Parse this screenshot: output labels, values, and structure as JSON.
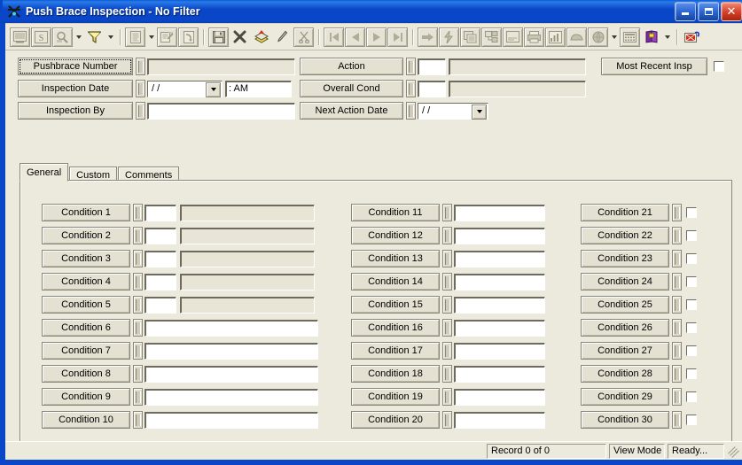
{
  "window": {
    "title": "Push Brace Inspection - No Filter",
    "app_icon": "push-brace-icon",
    "minimize_label": "Minimize",
    "maximize_label": "Maximize",
    "close_label": "Close"
  },
  "toolbar": {
    "groups": [
      {
        "buttons": [
          {
            "name": "design-view-icon",
            "label": "Design View",
            "dropdown": false,
            "enabled": false
          },
          {
            "name": "sort-records-icon",
            "label": "Sort Records",
            "dropdown": false,
            "enabled": false
          },
          {
            "name": "find-icon",
            "label": "Find",
            "dropdown": true,
            "enabled": false
          },
          {
            "name": "filter-funnel-icon",
            "label": "Filter",
            "dropdown": true,
            "enabled": true
          },
          {
            "name": "report-icon",
            "label": "Report",
            "dropdown": true,
            "enabled": false
          },
          {
            "name": "properties-icon",
            "label": "Properties",
            "dropdown": false,
            "enabled": false
          },
          {
            "name": "export-icon",
            "label": "Export",
            "dropdown": false,
            "enabled": false
          }
        ]
      },
      {
        "buttons": [
          {
            "name": "save-icon",
            "label": "Save",
            "dropdown": false,
            "enabled": false
          },
          {
            "name": "delete-icon",
            "label": "Delete",
            "dropdown": false,
            "enabled": true
          },
          {
            "name": "new-record-icon",
            "label": "New Record",
            "dropdown": false,
            "enabled": true
          },
          {
            "name": "edit-pencil-icon",
            "label": "Edit",
            "dropdown": false,
            "enabled": true
          },
          {
            "name": "cut-scissors-icon",
            "label": "Cut",
            "dropdown": false,
            "enabled": false
          }
        ]
      },
      {
        "buttons": [
          {
            "name": "first-record-icon",
            "label": "First Record",
            "dropdown": false,
            "enabled": false
          },
          {
            "name": "previous-record-icon",
            "label": "Previous Record",
            "dropdown": false,
            "enabled": false
          },
          {
            "name": "next-record-icon",
            "label": "Next Record",
            "dropdown": false,
            "enabled": false
          },
          {
            "name": "last-record-icon",
            "label": "Last Record",
            "dropdown": false,
            "enabled": false
          }
        ]
      },
      {
        "buttons": [
          {
            "name": "goto-icon",
            "label": "Go To",
            "dropdown": false,
            "enabled": false
          },
          {
            "name": "lightning-icon",
            "label": "Run",
            "dropdown": false,
            "enabled": false
          },
          {
            "name": "photos-icon",
            "label": "Photos",
            "dropdown": false,
            "enabled": false
          },
          {
            "name": "documents-icon",
            "label": "Documents",
            "dropdown": false,
            "enabled": false
          },
          {
            "name": "notes-icon",
            "label": "Notes",
            "dropdown": false,
            "enabled": false
          },
          {
            "name": "print-icon",
            "label": "Print",
            "dropdown": false,
            "enabled": false
          },
          {
            "name": "chart-icon",
            "label": "Chart",
            "dropdown": false,
            "enabled": false
          },
          {
            "name": "map-icon",
            "label": "Map",
            "dropdown": false,
            "enabled": false
          },
          {
            "name": "globe-icon",
            "label": "GIS",
            "dropdown": true,
            "enabled": false
          },
          {
            "name": "calculator-icon",
            "label": "Calculator",
            "dropdown": false,
            "enabled": false
          },
          {
            "name": "help-book-icon",
            "label": "Help",
            "dropdown": true,
            "enabled": true
          }
        ]
      },
      {
        "buttons": [
          {
            "name": "exit-icon",
            "label": "Exit",
            "dropdown": false,
            "enabled": true
          }
        ]
      }
    ]
  },
  "header": {
    "fields": [
      {
        "label": "Pushbrace Number",
        "name": "pushbrace-number",
        "type": "text",
        "value": "",
        "focused": true
      },
      {
        "label": "Inspection Date",
        "name": "inspection-date",
        "type": "date-time",
        "date_value": "/  /",
        "time_value": ":    AM"
      },
      {
        "label": "Inspection By",
        "name": "inspection-by",
        "type": "text",
        "value": ""
      },
      {
        "label": "Action",
        "name": "action",
        "type": "code-desc",
        "code_value": "",
        "desc_value": ""
      },
      {
        "label": "Overall Cond",
        "name": "overall-cond",
        "type": "code-desc",
        "code_value": "",
        "desc_value": ""
      },
      {
        "label": "Next Action Date",
        "name": "next-action-date",
        "type": "date",
        "date_value": "/  /"
      }
    ],
    "most_recent_insp": {
      "label": "Most Recent Insp",
      "name": "most-recent-insp",
      "checked": false
    }
  },
  "tabs": [
    {
      "label": "General",
      "name": "tab-general",
      "active": true
    },
    {
      "label": "Custom",
      "name": "tab-custom",
      "active": false
    },
    {
      "label": "Comments",
      "name": "tab-comments",
      "active": false
    }
  ],
  "general_tab": {
    "column1": [
      {
        "label": "Condition 1",
        "type": "code-desc",
        "code_value": "",
        "desc_value": ""
      },
      {
        "label": "Condition 2",
        "type": "code-desc",
        "code_value": "",
        "desc_value": ""
      },
      {
        "label": "Condition 3",
        "type": "code-desc",
        "code_value": "",
        "desc_value": ""
      },
      {
        "label": "Condition 4",
        "type": "code-desc",
        "code_value": "",
        "desc_value": ""
      },
      {
        "label": "Condition 5",
        "type": "code-desc",
        "code_value": "",
        "desc_value": ""
      },
      {
        "label": "Condition 6",
        "type": "text",
        "value": ""
      },
      {
        "label": "Condition 7",
        "type": "text",
        "value": ""
      },
      {
        "label": "Condition 8",
        "type": "text",
        "value": ""
      },
      {
        "label": "Condition 9",
        "type": "text",
        "value": ""
      },
      {
        "label": "Condition 10",
        "type": "text",
        "value": ""
      }
    ],
    "column2": [
      {
        "label": "Condition 11",
        "type": "text",
        "value": ""
      },
      {
        "label": "Condition 12",
        "type": "text",
        "value": ""
      },
      {
        "label": "Condition 13",
        "type": "text",
        "value": ""
      },
      {
        "label": "Condition 14",
        "type": "text",
        "value": ""
      },
      {
        "label": "Condition 15",
        "type": "text",
        "value": ""
      },
      {
        "label": "Condition 16",
        "type": "text",
        "value": ""
      },
      {
        "label": "Condition 17",
        "type": "text",
        "value": ""
      },
      {
        "label": "Condition 18",
        "type": "text",
        "value": ""
      },
      {
        "label": "Condition 19",
        "type": "text",
        "value": ""
      },
      {
        "label": "Condition 20",
        "type": "text",
        "value": ""
      }
    ],
    "column3": [
      {
        "label": "Condition 21",
        "type": "checkbox",
        "checked": false
      },
      {
        "label": "Condition 22",
        "type": "checkbox",
        "checked": false
      },
      {
        "label": "Condition 23",
        "type": "checkbox",
        "checked": false
      },
      {
        "label": "Condition 24",
        "type": "checkbox",
        "checked": false
      },
      {
        "label": "Condition 25",
        "type": "checkbox",
        "checked": false
      },
      {
        "label": "Condition 26",
        "type": "checkbox",
        "checked": false
      },
      {
        "label": "Condition 27",
        "type": "checkbox",
        "checked": false
      },
      {
        "label": "Condition 28",
        "type": "checkbox",
        "checked": false
      },
      {
        "label": "Condition 29",
        "type": "checkbox",
        "checked": false
      },
      {
        "label": "Condition 30",
        "type": "checkbox",
        "checked": false
      }
    ]
  },
  "statusbar": {
    "record_count": "Record 0 of 0",
    "mode": "View Mode",
    "status": "Ready..."
  },
  "colors": {
    "titlebar_blue": "#0A46C8",
    "window_face": "#ECE9DD",
    "button_face": "#E4E0D2",
    "readonly_field": "#E8E4D6",
    "field_white": "#FFFFFF",
    "border_dark": "#8A8778",
    "close_red": "#D8442C",
    "funnel_yellow": "#F2E04A"
  }
}
